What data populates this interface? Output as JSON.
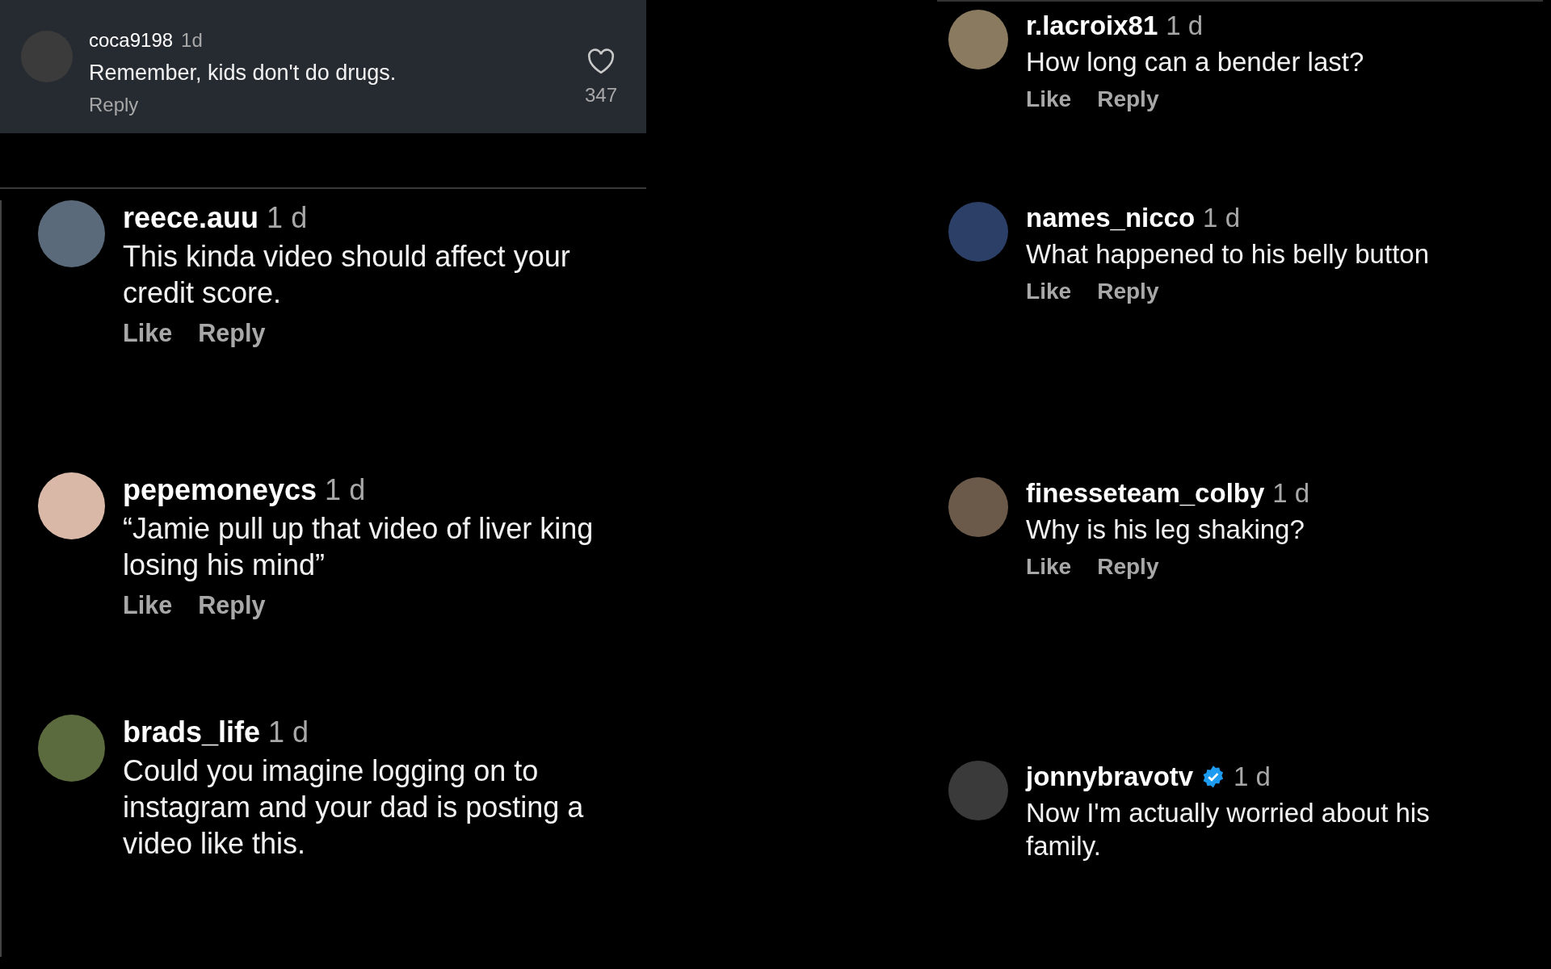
{
  "top_comment": {
    "username": "coca9198",
    "time": "1d",
    "text": "Remember, kids don't do drugs.",
    "reply": "Reply",
    "likes": "347"
  },
  "left_comments": [
    {
      "username": "reece.auu",
      "verified": false,
      "time": "1 d",
      "text": "This kinda video should affect your credit score.",
      "like": "Like",
      "reply": "Reply"
    },
    {
      "username": "pepemoneycs",
      "verified": false,
      "time": "1 d",
      "text": "“Jamie pull up that video of liver king losing his mind”",
      "like": "Like",
      "reply": "Reply"
    },
    {
      "username": "brads_life",
      "verified": false,
      "time": "1 d",
      "text": "Could you imagine logging on to instagram and your dad is posting a video like this."
    }
  ],
  "right_comments": [
    {
      "username": "r.lacroix81",
      "verified": false,
      "time": "1 d",
      "text": "How long can a bender last?",
      "like": "Like",
      "reply": "Reply"
    },
    {
      "username": "names_nicco",
      "verified": false,
      "time": "1 d",
      "text": "What happened to his belly button",
      "like": "Like",
      "reply": "Reply"
    },
    {
      "username": "finesseteam_colby",
      "verified": false,
      "time": "1 d",
      "text": "Why is his leg shaking?",
      "like": "Like",
      "reply": "Reply"
    },
    {
      "username": "jonnybravotv",
      "verified": true,
      "time": "1 d",
      "text": "Now I'm actually worried about his family."
    }
  ]
}
